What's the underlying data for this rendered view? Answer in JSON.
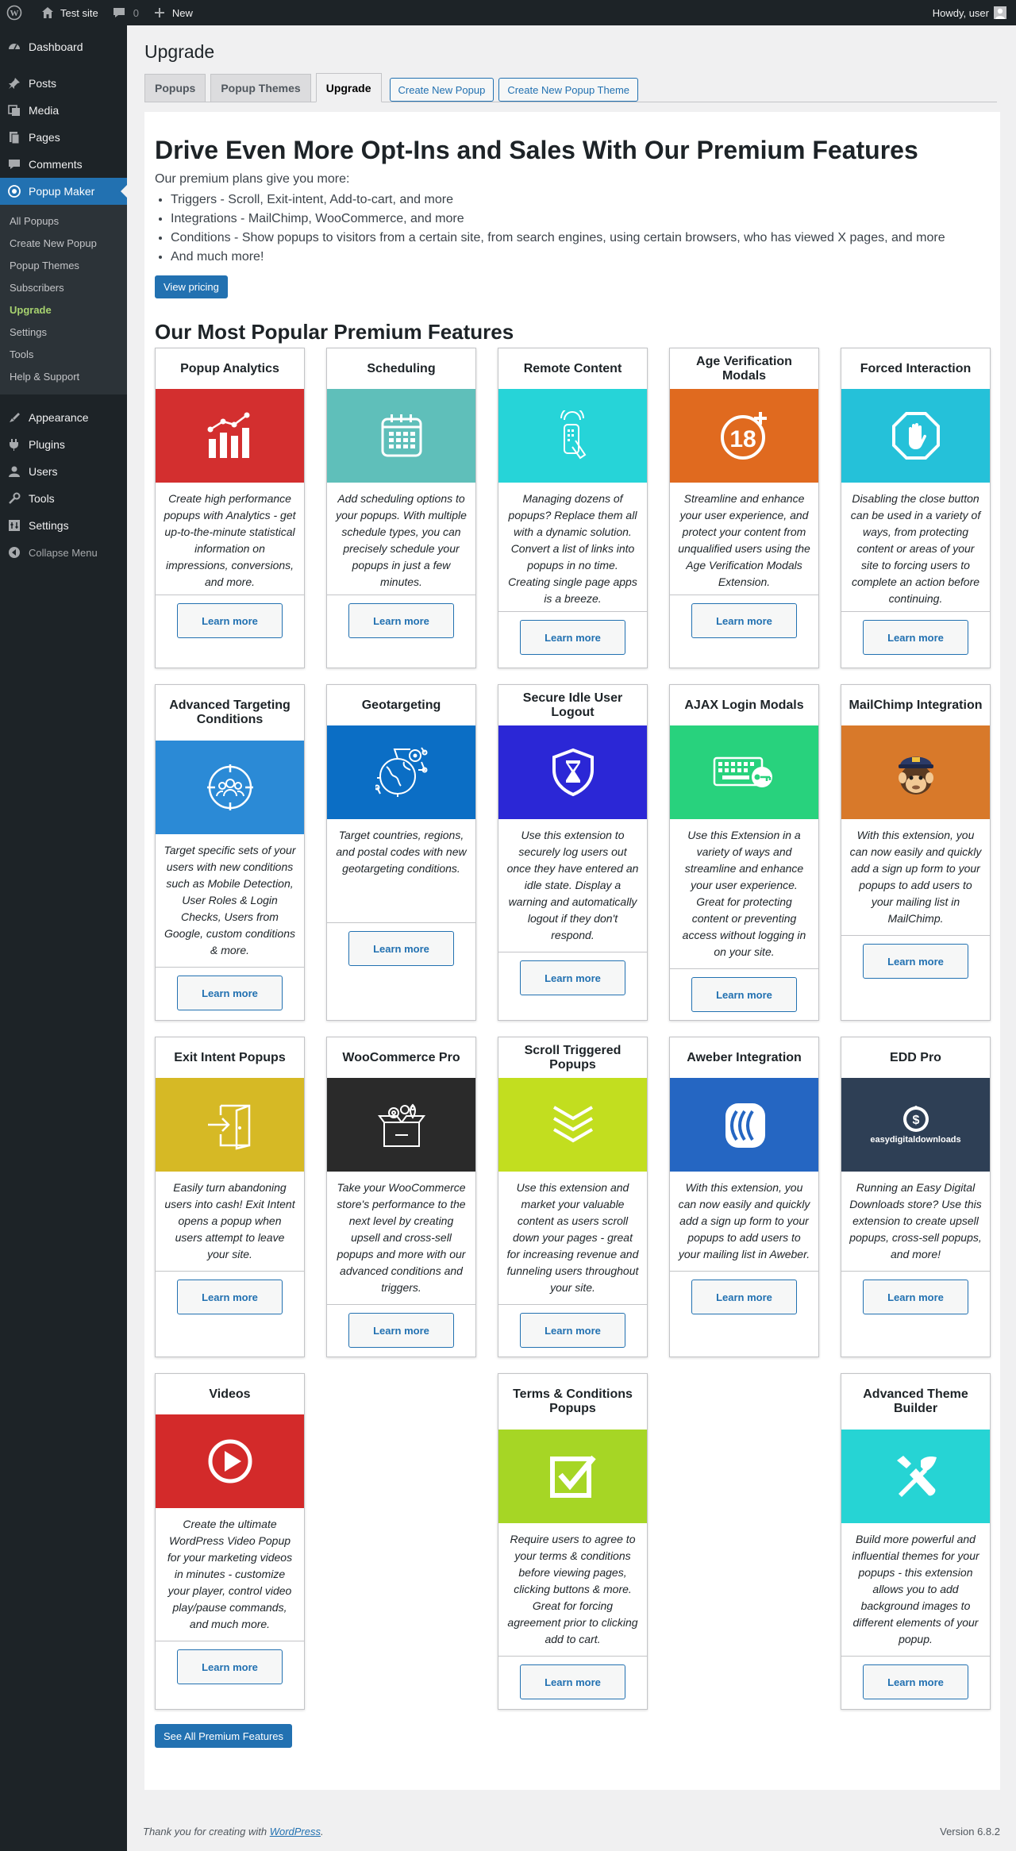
{
  "admin_bar": {
    "site_name": "Test site",
    "comments_count": "0",
    "new_label": "New",
    "greeting": "Howdy, user"
  },
  "sidebar": {
    "items": [
      {
        "label": "Dashboard",
        "icon": "dashboard-icon"
      },
      {
        "label": "Posts",
        "icon": "pin-icon"
      },
      {
        "label": "Media",
        "icon": "media-icon"
      },
      {
        "label": "Pages",
        "icon": "pages-icon"
      },
      {
        "label": "Comments",
        "icon": "comments-icon"
      },
      {
        "label": "Popup Maker",
        "icon": "popup-maker-icon"
      }
    ],
    "submenu": [
      "All Popups",
      "Create New Popup",
      "Popup Themes",
      "Subscribers",
      "Upgrade",
      "Settings",
      "Tools",
      "Help & Support"
    ],
    "items_after": [
      {
        "label": "Appearance",
        "icon": "appearance-icon"
      },
      {
        "label": "Plugins",
        "icon": "plugins-icon"
      },
      {
        "label": "Users",
        "icon": "users-icon"
      },
      {
        "label": "Tools",
        "icon": "tools-icon"
      },
      {
        "label": "Settings",
        "icon": "settings-icon"
      }
    ],
    "collapse_label": "Collapse Menu"
  },
  "page": {
    "title": "Upgrade",
    "tabs": [
      "Popups",
      "Popup Themes",
      "Upgrade"
    ],
    "tab_buttons": [
      "Create New Popup",
      "Create New Popup Theme"
    ]
  },
  "hero": {
    "title": "Drive Even More Opt-Ins and Sales With Our Premium Features",
    "subtitle": "Our premium plans give you more:",
    "bullets": [
      "Triggers - Scroll, Exit-intent, Add-to-cart, and more",
      "Integrations - MailChimp, WooCommerce, and more",
      "Conditions - Show popups to visitors from a certain site, from search engines, using certain browsers, who has viewed X pages, and more",
      "And much more!"
    ],
    "pricing_button": "View pricing"
  },
  "features_title": "Our Most Popular Premium Features",
  "learn_more": "Learn more",
  "cards": [
    {
      "title": "Popup Analytics",
      "color": "#d32f2f",
      "icon": "analytics-chart-icon",
      "desc": "Create high performance popups with Analytics - get up-to-the-minute statistical information on impressions, conversions, and more."
    },
    {
      "title": "Scheduling",
      "color": "#5fbfba",
      "icon": "calendar-icon",
      "desc": "Add scheduling options to your popups. With multiple schedule types, you can precisely schedule your popups in just a few minutes."
    },
    {
      "title": "Remote Content",
      "color": "#26d4d8",
      "icon": "remote-touch-icon",
      "desc": "Managing dozens of popups? Replace them all with a dynamic solution. Convert a list of links into popups in no time. Creating single page apps is a breeze."
    },
    {
      "title": "Age Verification Modals",
      "color": "#e06a1f",
      "icon": "age-18-icon",
      "desc": "Streamline and enhance your user experience, and protect your content from unqualified users using the Age Verification Modals Extension."
    },
    {
      "title": "Forced Interaction",
      "color": "#25c1d9",
      "icon": "stop-hand-icon",
      "desc": "Disabling the close button can be used in a variety of ways, from protecting content or areas of your site to forcing users to complete an action before continuing."
    },
    {
      "title": "Advanced Targeting Conditions",
      "color": "#2b8ad6",
      "icon": "target-users-icon",
      "desc": "Target specific sets of your users with new conditions such as Mobile Detection, User Roles & Login Checks, Users from Google, custom conditions & more."
    },
    {
      "title": "Geotargeting",
      "color": "#0b6ec5",
      "icon": "globe-pin-icon",
      "desc": "Target countries, regions, and postal codes with new geotargeting conditions."
    },
    {
      "title": "Secure Idle User Logout",
      "color": "#2b27d6",
      "icon": "shield-hourglass-icon",
      "desc": "Use this extension to securely log users out once they have entered an idle state. Display a warning and automatically logout if they don't respond."
    },
    {
      "title": "AJAX Login Modals",
      "color": "#28d27d",
      "icon": "keyboard-key-icon",
      "desc": "Use this Extension in a variety of ways and streamline and enhance your user experience. Great for protecting content or preventing access without logging in on your site."
    },
    {
      "title": "MailChimp Integration",
      "color": "#d8792a",
      "icon": "mailchimp-icon",
      "desc": "With this extension, you can now easily and quickly add a sign up form to your popups to add users to your mailing list in MailChimp."
    },
    {
      "title": "Exit Intent Popups",
      "color": "#d6b925",
      "icon": "exit-door-icon",
      "desc": "Easily turn abandoning users into cash! Exit Intent opens a popup when users attempt to leave your site."
    },
    {
      "title": "WooCommerce Pro",
      "color": "#2a2a2a",
      "icon": "woocommerce-box-icon",
      "desc": "Take your WooCommerce store's performance to the next level by creating upsell and cross-sell popups and more with our advanced conditions and triggers."
    },
    {
      "title": "Scroll Triggered Popups",
      "color": "#c2de1f",
      "icon": "scroll-chevrons-icon",
      "desc": "Use this extension and market your valuable content as users scroll down your pages - great for increasing revenue and funneling users throughout your site."
    },
    {
      "title": "Aweber Integration",
      "color": "#2566c2",
      "icon": "aweber-icon",
      "desc": "With this extension, you can now easily and quickly add a sign up form to your popups to add users to your mailing list in Aweber."
    },
    {
      "title": "EDD Pro",
      "color": "#2e3f55",
      "icon": "easy-digital-downloads-logo-icon",
      "logo_text": "easydigitaldownloads",
      "desc": "Running an Easy Digital Downloads store? Use this extension to create upsell popups, cross-sell popups, and more!"
    },
    {
      "title": "Videos",
      "color": "#d32a2a",
      "icon": "play-icon",
      "desc": "Create the ultimate WordPress Video Popup for your marketing videos in minutes - customize your player, control video play/pause commands, and much more."
    },
    {
      "title": "Terms & Conditions Popups",
      "color": "#a6d625",
      "icon": "checkbox-icon",
      "desc": "Require users to agree to your terms & conditions before viewing pages, clicking buttons & more. Great for forcing agreement prior to clicking add to cart."
    },
    {
      "title": "Advanced Theme Builder",
      "color": "#26d4d4",
      "icon": "tools-cross-icon",
      "desc": "Build more powerful and influential themes for your popups - this extension allows you to add background images to different elements of your popup."
    }
  ],
  "see_all_button": "See All Premium Features",
  "footer": {
    "thanks_prefix": "Thank you for creating with",
    "wp_link": "WordPress",
    "thanks_suffix": ".",
    "version": "Version 6.8.2"
  }
}
